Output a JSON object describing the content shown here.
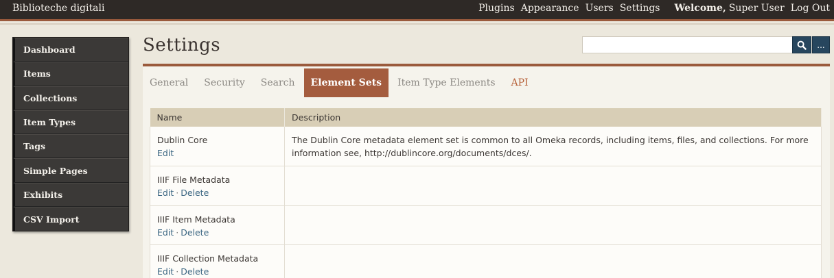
{
  "header": {
    "site_title": "Biblioteche digitali",
    "nav": [
      "Plugins",
      "Appearance",
      "Users",
      "Settings"
    ],
    "welcome": "Welcome,",
    "user": "Super User",
    "logout": "Log Out"
  },
  "sidebar": {
    "items": [
      {
        "label": "Dashboard"
      },
      {
        "label": "Items"
      },
      {
        "label": "Collections"
      },
      {
        "label": "Item Types"
      },
      {
        "label": "Tags"
      },
      {
        "label": "Simple Pages"
      },
      {
        "label": "Exhibits"
      },
      {
        "label": "CSV Import"
      }
    ]
  },
  "page": {
    "title": "Settings"
  },
  "search": {
    "placeholder": "",
    "advanced_label": "..."
  },
  "tabs": [
    {
      "label": "General"
    },
    {
      "label": "Security"
    },
    {
      "label": "Search"
    },
    {
      "label": "Element Sets"
    },
    {
      "label": "Item Type Elements"
    },
    {
      "label": "API"
    }
  ],
  "table": {
    "columns": [
      "Name",
      "Description"
    ],
    "rows": [
      {
        "name": "Dublin Core",
        "actions": [
          "Edit"
        ],
        "description": "The Dublin Core metadata element set is common to all Omeka records, including items, files, and collections. For more information see, http://dublincore.org/documents/dces/."
      },
      {
        "name": "IIIF File Metadata",
        "actions": [
          "Edit",
          "Delete"
        ],
        "description": ""
      },
      {
        "name": "IIIF Item Metadata",
        "actions": [
          "Edit",
          "Delete"
        ],
        "description": ""
      },
      {
        "name": "IIIF Collection Metadata",
        "actions": [
          "Edit",
          "Delete"
        ],
        "description": ""
      }
    ],
    "separator": "·"
  },
  "colors": {
    "topbar": "#2e2926",
    "accent": "#9a5a3c",
    "active_tab": "#a45c3e",
    "search_button": "#27465e",
    "link": "#3c6783"
  }
}
